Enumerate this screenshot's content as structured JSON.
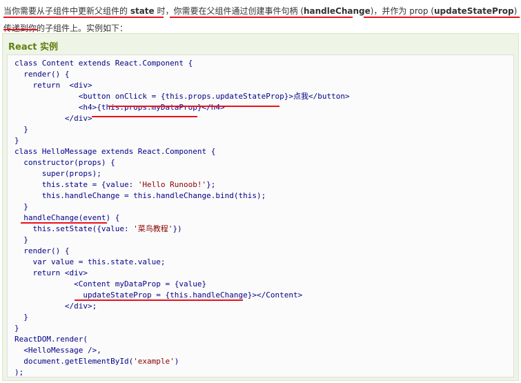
{
  "intro": {
    "parts": [
      "当你需要从子组件中更新父组件的 ",
      "state",
      " 时，你需要在父组件通过创建事件句柄 (",
      "handleChange",
      ")，并作为 prop (",
      "updateStateProp",
      ") 传递到你的子组件上。实例如下："
    ]
  },
  "example": {
    "title": "React 实例",
    "code": [
      {
        "plain": "class Content extends React.Component {"
      },
      {
        "plain": "  render() {"
      },
      {
        "plain": "    return  <div>"
      },
      {
        "plain": "              <button onClick = {this.props.updateStateProp}>点我</button>"
      },
      {
        "plain": "              <h4>{this.props.myDataProp}</h4>"
      },
      {
        "plain": "           </div>"
      },
      {
        "plain": "  }"
      },
      {
        "plain": "}"
      },
      {
        "plain": "class HelloMessage extends React.Component {"
      },
      {
        "plain": "  constructor(props) {"
      },
      {
        "plain": "      super(props);"
      },
      {
        "pre": "      this.state = {value: ",
        "str": "'Hello Runoob!'",
        "post": "};"
      },
      {
        "plain": "      this.handleChange = this.handleChange.bind(this);"
      },
      {
        "plain": "  }"
      },
      {
        "plain": "  handleChange(event) {"
      },
      {
        "pre": "    this.setState({value: ",
        "str": "'菜鸟教程'",
        "post": "})"
      },
      {
        "plain": "  }"
      },
      {
        "plain": "  render() {"
      },
      {
        "plain": "    var value = this.state.value;"
      },
      {
        "plain": "    return <div>"
      },
      {
        "plain": "             <Content myDataProp = {value}"
      },
      {
        "plain": "               updateStateProp = {this.handleChange}></Content>"
      },
      {
        "plain": "           </div>;"
      },
      {
        "plain": "  }"
      },
      {
        "plain": "}"
      },
      {
        "plain": "ReactDOM.render("
      },
      {
        "plain": "  <HelloMessage />,"
      },
      {
        "pre": "  document.getElementById(",
        "str": "'example'",
        "post": ")"
      },
      {
        "plain": ");"
      }
    ]
  },
  "colors": {
    "annotation": "#e8101a",
    "code_keyword": "#000088",
    "code_string": "#880000",
    "title": "#617f10"
  }
}
